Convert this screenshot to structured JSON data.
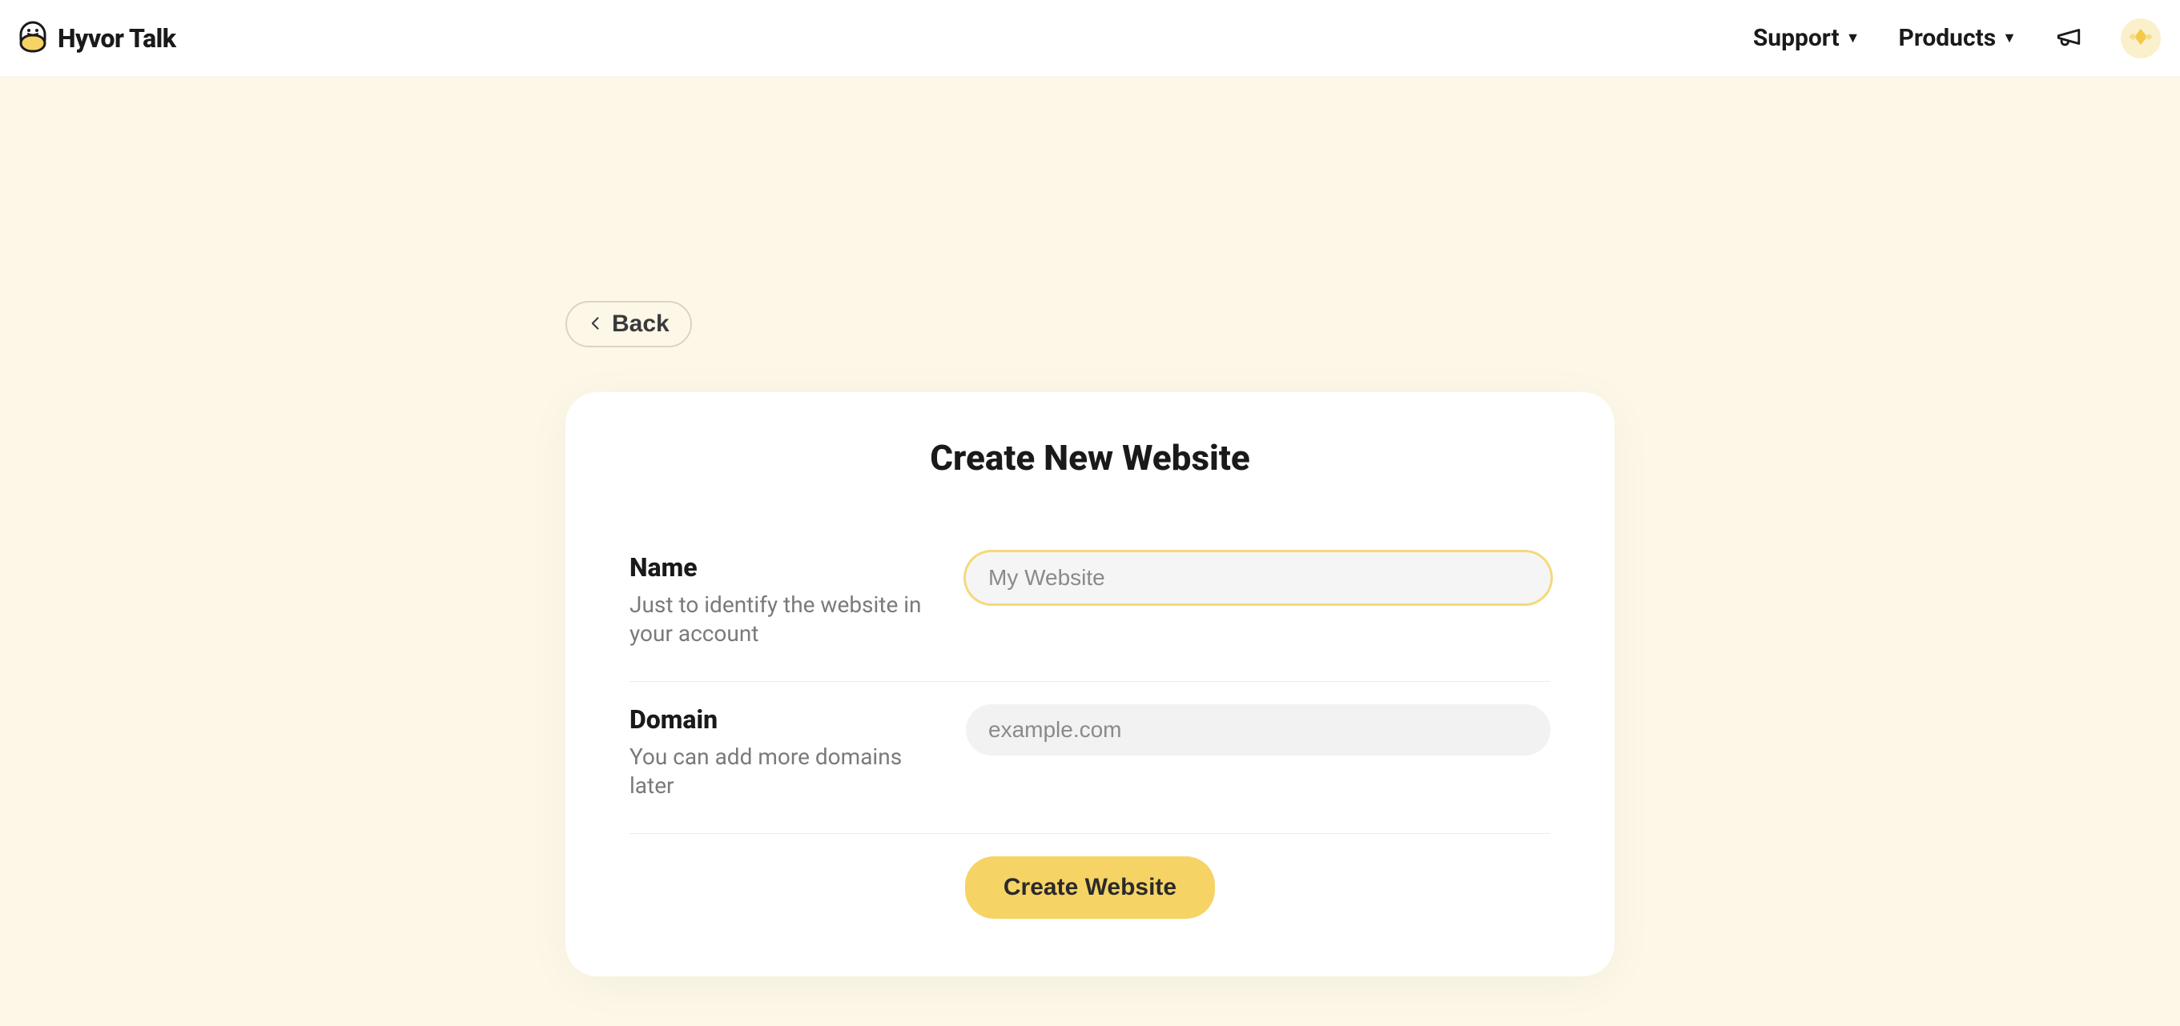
{
  "header": {
    "brand_name": "Hyvor Talk",
    "nav": {
      "support_label": "Support",
      "products_label": "Products"
    }
  },
  "page": {
    "back_label": "Back",
    "card_title": "Create New Website",
    "fields": {
      "name": {
        "label": "Name",
        "help": "Just to identify the website in your account",
        "placeholder": "My Website",
        "value": ""
      },
      "domain": {
        "label": "Domain",
        "help": "You can add more domains later",
        "placeholder": "example.com",
        "value": ""
      }
    },
    "submit_label": "Create Website"
  }
}
